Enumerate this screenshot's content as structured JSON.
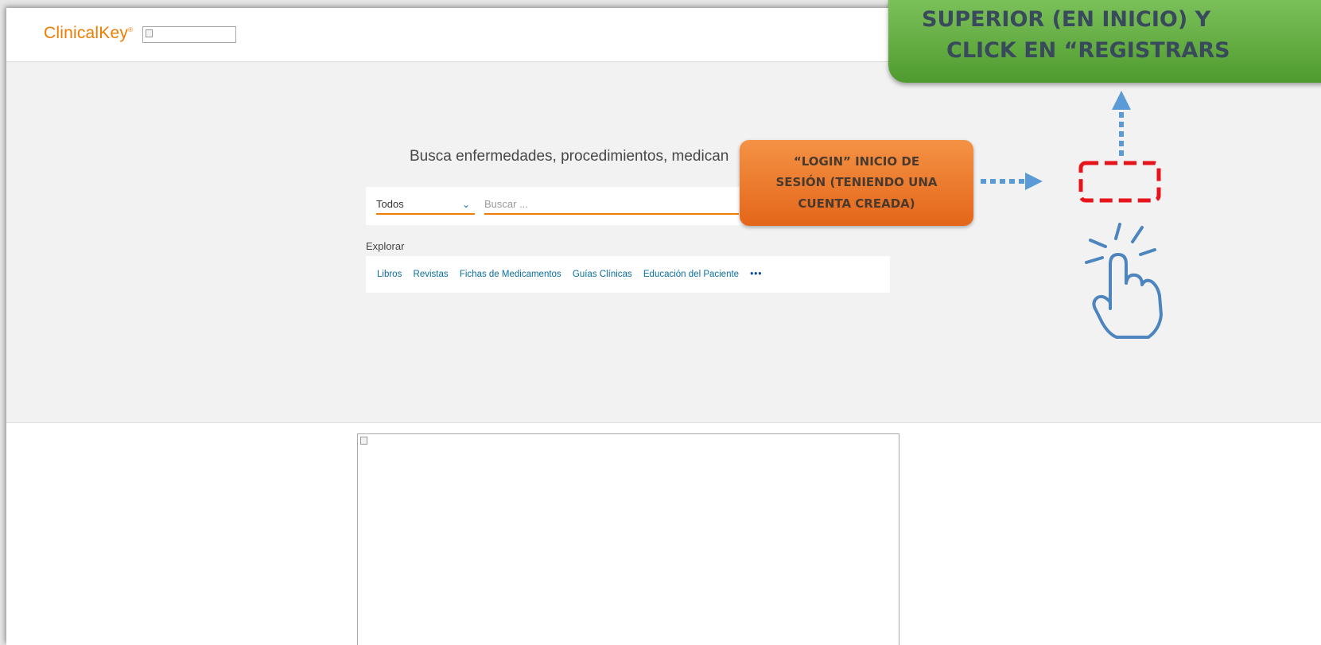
{
  "header": {
    "logo_text": "ClinicalKey",
    "logo_mark": "®",
    "brand_color": "#f07c00"
  },
  "hero": {
    "title": "Busca enfermedades, procedimientos, medican",
    "scope_select": {
      "value": "Todos"
    },
    "search": {
      "placeholder": "Buscar ..."
    }
  },
  "explore": {
    "label": "Explorar",
    "links": [
      "Libros",
      "Revistas",
      "Fichas de Medicamentos",
      "Guías Clínicas",
      "Educación del Paciente"
    ],
    "more": "•••"
  },
  "annotations": {
    "green_callout": {
      "line1": "SUPERIOR (EN INICIO) Y",
      "line2": "CLICK EN “REGISTRARS",
      "color": "#5fa93c",
      "text_color": "#384a5c"
    },
    "orange_callout": {
      "line1": "“LOGIN” INICIO DE",
      "line2": "SESIÓN (TENIENDO UNA",
      "line3": "CUENTA CREADA)",
      "color": "#ee7a2f"
    },
    "highlight_color": "#e8141c",
    "arrow_color": "#5b9bd5"
  }
}
